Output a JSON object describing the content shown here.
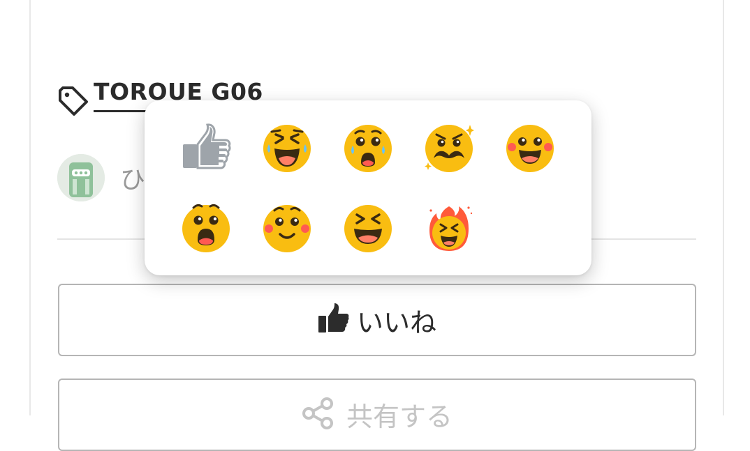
{
  "tag": {
    "label": "TOROUE G06",
    "icon": "tag-icon"
  },
  "author": {
    "name": "ひ",
    "avatar": "avatar"
  },
  "like_button": {
    "label": "いいね",
    "icon": "thumbs-up-icon"
  },
  "share_button": {
    "label": "共有する",
    "icon": "share-icon"
  },
  "reactions": [
    {
      "name": "like",
      "icon": "thumbs-up-reaction-icon"
    },
    {
      "name": "laughing",
      "icon": "laughing-tears-face-icon"
    },
    {
      "name": "crying",
      "icon": "crying-face-icon"
    },
    {
      "name": "mustache",
      "icon": "mustache-face-icon"
    },
    {
      "name": "happy",
      "icon": "happy-blush-face-icon"
    },
    {
      "name": "surprised",
      "icon": "surprised-face-icon"
    },
    {
      "name": "touched",
      "icon": "touched-blush-face-icon"
    },
    {
      "name": "grinning",
      "icon": "grinning-squint-face-icon"
    },
    {
      "name": "fire",
      "icon": "fire-face-icon"
    }
  ],
  "colors": {
    "emoji_yellow": "#F9BD11",
    "emoji_mouth": "#FF5A52",
    "emoji_tongue": "#FF7F66",
    "thumb_gray": "#9EA4AA",
    "text_dark": "#2B2B2B",
    "text_muted": "#9A9A9A"
  }
}
